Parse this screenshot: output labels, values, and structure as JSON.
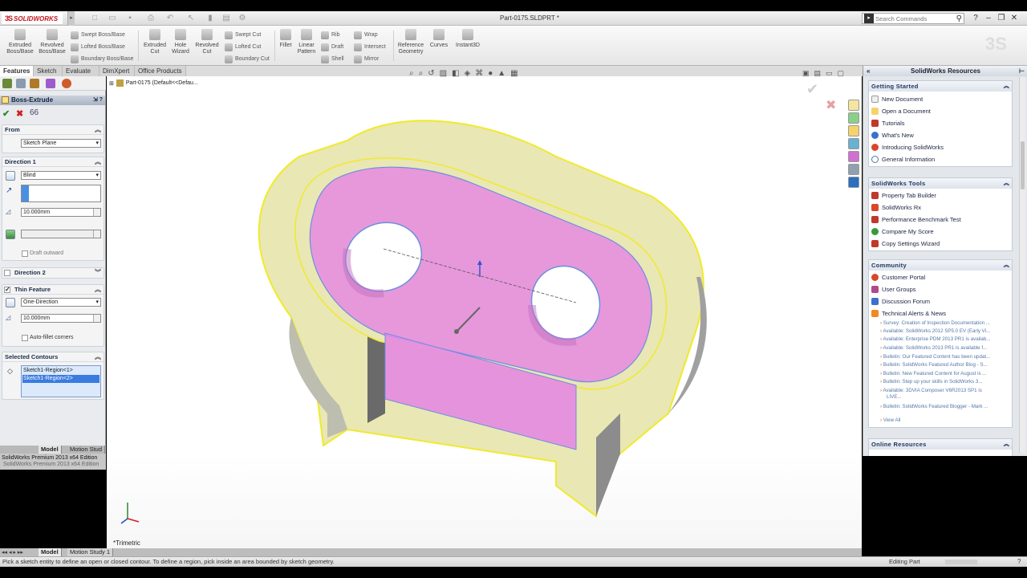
{
  "app": {
    "brand": "SOLIDWORKS",
    "document_title": "Part-0175.SLDPRT *",
    "search_placeholder": "Search Commands"
  },
  "ribbon": {
    "big_buttons": [
      {
        "label": "Extruded\nBoss/Base",
        "icon": "extruded-boss-icon"
      },
      {
        "label": "Revolved\nBoss/Base",
        "icon": "revolved-boss-icon"
      },
      {
        "label": "Extruded\nCut",
        "icon": "extruded-cut-icon"
      },
      {
        "label": "Hole\nWizard",
        "icon": "hole-wizard-icon"
      },
      {
        "label": "Revolved\nCut",
        "icon": "revolved-cut-icon"
      },
      {
        "label": "Fillet",
        "icon": "fillet-icon"
      },
      {
        "label": "Linear\nPattern",
        "icon": "linear-pattern-icon"
      },
      {
        "label": "Reference\nGeometry",
        "icon": "reference-geometry-icon"
      },
      {
        "label": "Curves",
        "icon": "curves-icon"
      },
      {
        "label": "Instant3D",
        "icon": "instant3d-icon"
      }
    ],
    "small_buttons": {
      "boss": [
        "Swept Boss/Base",
        "Lofted Boss/Base",
        "Boundary Boss/Base"
      ],
      "cut": [
        "Swept Cut",
        "Lofted Cut",
        "Boundary Cut"
      ],
      "features": [
        "Rib",
        "Draft",
        "Shell"
      ],
      "more": [
        "Wrap",
        "Intersect",
        "Mirror"
      ]
    }
  },
  "tabs": [
    "Features",
    "Sketch",
    "Evaluate",
    "DimXpert",
    "Office Products"
  ],
  "property_manager": {
    "title": "Boss-Extrude",
    "from": {
      "header": "From",
      "value": "Sketch Plane"
    },
    "direction1": {
      "header": "Direction 1",
      "end_condition": "Blind",
      "depth": "10.000mm",
      "draft_label": "Draft outward"
    },
    "direction2": {
      "header": "Direction 2"
    },
    "thin_feature": {
      "header": "Thin Feature",
      "type": "One-Direction",
      "thickness": "10.000mm",
      "auto_fillet_label": "Auto-fillet corners"
    },
    "selected_contours": {
      "header": "Selected Contours",
      "items": [
        "Sketch1-Region<1>",
        "Sketch1-Region<2>"
      ]
    },
    "bottom_tabs": [
      "Model",
      "Motion Stud"
    ],
    "edition": "SolidWorks Premium 2013 x64 Edition",
    "edition_ghost": "SolidWorks Premium 2013 x64 Edition"
  },
  "viewport": {
    "tree_item": "Part-0175  (Default<<Defau...",
    "view_label": "*Trimetric",
    "colors": {
      "body": "#ecebb6",
      "outline": "#f2ee2a",
      "preview": "#e58ae2",
      "sketch": "#6a8fe0"
    }
  },
  "bottom_tabs": [
    "Model",
    "Motion Study 1"
  ],
  "status": {
    "message": "Pick a sketch entity to define an open or closed contour. To define a region, pick inside an area bounded by sketch geometry.",
    "mode": "Editing Part"
  },
  "task_pane": {
    "title": "SolidWorks Resources",
    "getting_started": {
      "header": "Getting Started",
      "items": [
        "New Document",
        "Open a Document",
        "Tutorials",
        "What's New",
        "Introducing SolidWorks",
        "General Information"
      ]
    },
    "tools": {
      "header": "SolidWorks Tools",
      "items": [
        "Property Tab Builder",
        "SolidWorks Rx",
        "Performance Benchmark Test",
        "Compare My Score",
        "Copy Settings Wizard"
      ]
    },
    "community": {
      "header": "Community",
      "items": [
        "Customer Portal",
        "User Groups",
        "Discussion Forum",
        "Technical Alerts & News"
      ],
      "news": [
        "Survey: Creation of Inspection Documentation ...",
        "Available: SolidWorks 2012 SP5.0 EV (Early Vi...",
        "Available: Enterprise PDM 2013 PR1 is availab...",
        "Available: SolidWorks 2013 PR1 is available f...",
        "Bulletin: Our Featured Content has been updat...",
        "Bulletin: SolidWorks Featured Author Blog - S...",
        "Bulletin: New Featured Content for August is ...",
        "Bulletin: Step up your skills in SolidWorks 3...",
        "Available: 3DVIA Composer V6R2013 SP1 is",
        "LIVE...",
        "Bulletin: SolidWorks Featured Blogger - Mark ..."
      ],
      "view_all": "View All"
    },
    "online": {
      "header": "Online Resources"
    }
  }
}
